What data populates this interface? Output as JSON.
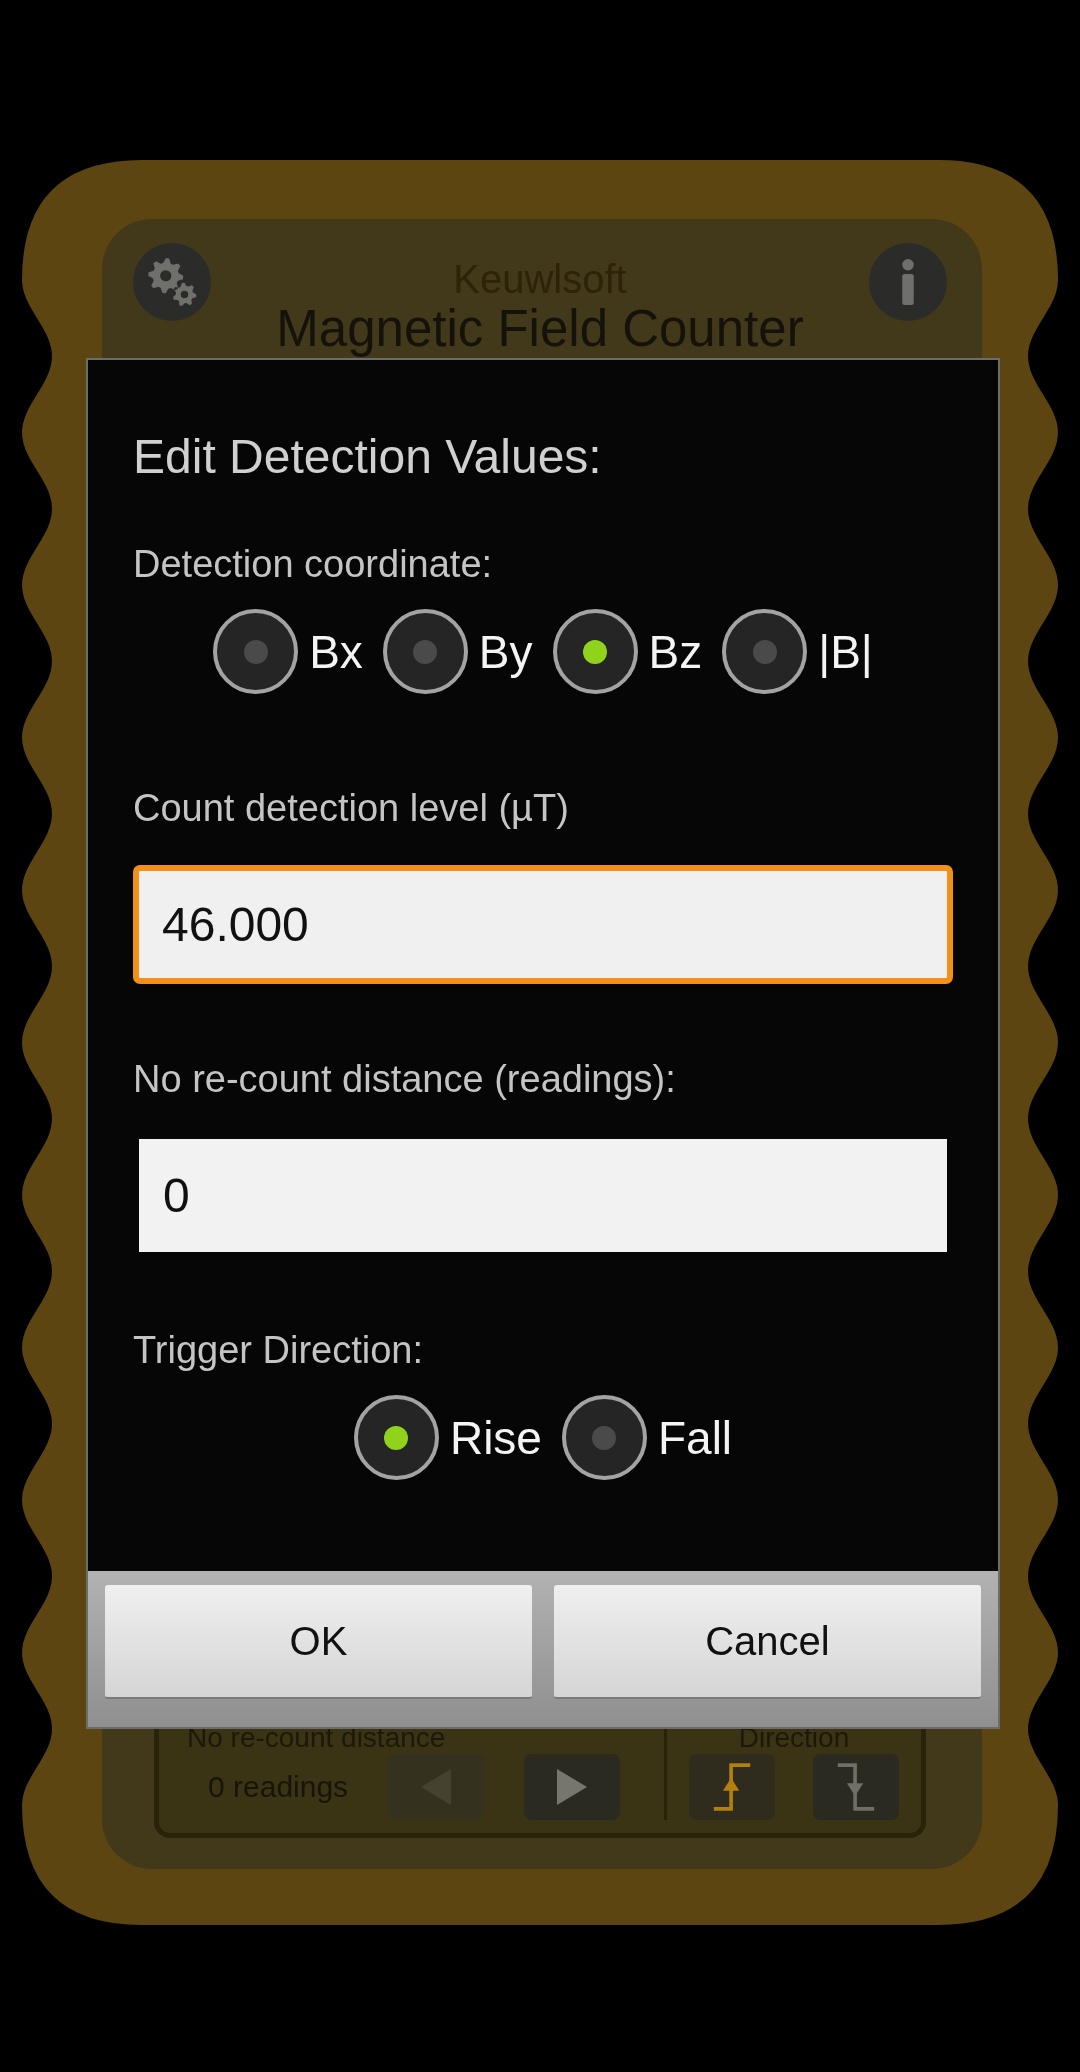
{
  "app": {
    "brand": "Keuwlsoft",
    "title": "Magnetic Field Counter"
  },
  "control_panel": {
    "distance_label": "No re-count distance",
    "distance_value": "0 readings",
    "step_buttons": [
      {
        "kind": "previous",
        "disabled": true
      },
      {
        "kind": "next",
        "disabled": false
      }
    ],
    "direction_label": "Direction",
    "direction_buttons": [
      {
        "kind": "rise",
        "selected": true
      },
      {
        "kind": "fall",
        "selected": false
      }
    ]
  },
  "dialog": {
    "title": "Edit Detection Values:",
    "sections": [
      {
        "kind": "radio",
        "label": "Detection coordinate:",
        "options": [
          {
            "label": "Bx",
            "selected": false
          },
          {
            "label": "By",
            "selected": false
          },
          {
            "label": "Bz",
            "selected": true
          },
          {
            "label": "|B|",
            "selected": false
          }
        ]
      },
      {
        "kind": "input",
        "label": "Count detection level (µT)",
        "value": "46.000",
        "focused": true
      },
      {
        "kind": "input",
        "label": "No re-count distance (readings):",
        "value": "0",
        "focused": false
      },
      {
        "kind": "radio",
        "label": "Trigger Direction:",
        "options": [
          {
            "label": "Rise",
            "selected": true
          },
          {
            "label": "Fall",
            "selected": false
          }
        ]
      }
    ],
    "buttons": [
      "OK",
      "Cancel"
    ]
  }
}
